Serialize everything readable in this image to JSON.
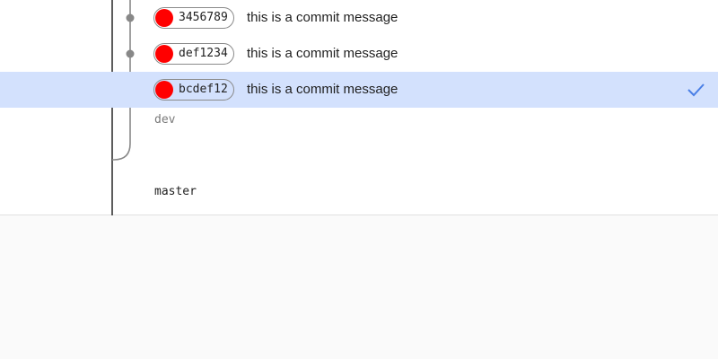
{
  "commits": [
    {
      "hash": "3456789",
      "message": "this is a commit message",
      "selected": false
    },
    {
      "hash": "def1234",
      "message": "this is a commit message",
      "selected": false
    },
    {
      "hash": "bcdef12",
      "message": "this is a commit message",
      "selected": true
    }
  ],
  "branches": {
    "dev": "dev",
    "master": "master"
  },
  "colors": {
    "selected_row": "#d3e1fd",
    "commit_dot": "#ff0000",
    "check": "#4a7fe6",
    "graph_line": "#888888",
    "master_line": "#333333"
  },
  "icons": {
    "selected_indicator": "checkmark-icon"
  }
}
